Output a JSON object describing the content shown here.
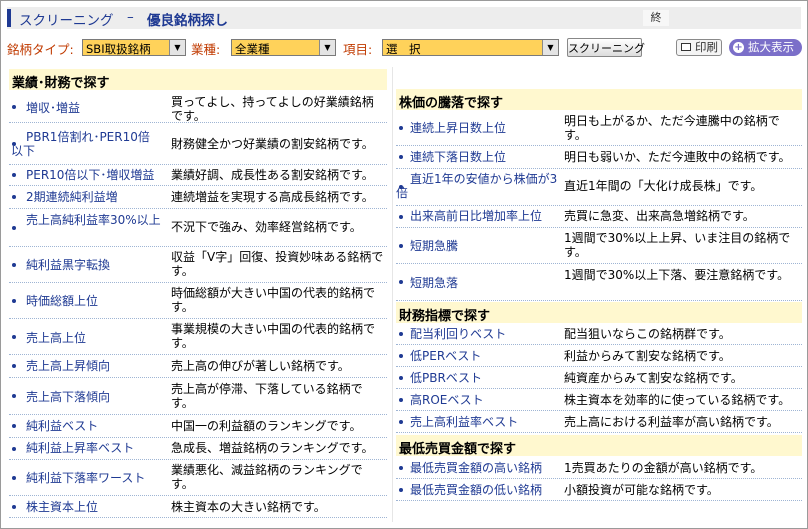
{
  "window": {
    "title_main": "スクリーニング",
    "title_sep": "–",
    "title_sub": "優良銘柄探し",
    "close_label": "終"
  },
  "toolbar": {
    "stock_type_label": "銘柄タイプ:",
    "stock_type_value": "SBI取扱銘柄",
    "industry_label": "業種:",
    "industry_value": "全業種",
    "item_label": "項目:",
    "item_value": "選　択",
    "screening_button": "スクリーニング",
    "print_button": "印刷",
    "zoom_button": "拡大表示",
    "accent_color": "#ffd25a",
    "label_color": "#c03a00"
  },
  "left": {
    "section_title": "業績･財務で探す",
    "rows": [
      {
        "link": "増収･増益",
        "desc": "買ってよし、持ってよしの好業績銘柄です。"
      },
      {
        "link": "PBR1倍割れ･PER10倍以下",
        "desc": "財務健全かつ好業績の割安銘柄です。"
      },
      {
        "link": "PER10倍以下･増収増益",
        "desc": "業績好調、成長性ある割安銘柄です。"
      },
      {
        "link": "2期連続純利益増",
        "desc": "連続増益を実現する高成長銘柄です。"
      },
      {
        "link": "売上高純利益率30%以上",
        "desc": "不況下で強み、効率経営銘柄です。"
      },
      {
        "link": "純利益黒字転換",
        "desc": "収益「V字」回復、投資妙味ある銘柄です。"
      },
      {
        "link": "時価総額上位",
        "desc": "時価総額が大きい中国の代表的銘柄です。"
      },
      {
        "link": "売上高上位",
        "desc": "事業規模の大きい中国の代表的銘柄です。"
      },
      {
        "link": "売上高上昇傾向",
        "desc": "売上高の伸びが著しい銘柄です。"
      },
      {
        "link": "売上高下落傾向",
        "desc": "売上高が停滞、下落している銘柄です。"
      },
      {
        "link": "純利益ベスト",
        "desc": "中国一の利益額のランキングです。"
      },
      {
        "link": "純利益上昇率ベスト",
        "desc": "急成長、増益銘柄のランキングです。"
      },
      {
        "link": "純利益下落率ワースト",
        "desc": "業績悪化、減益銘柄のランキングです。"
      },
      {
        "link": "株主資本上位",
        "desc": "株主資本の大きい銘柄です。"
      }
    ]
  },
  "right": {
    "section1_title": "株価の騰落で探す",
    "section1_rows": [
      {
        "link": "連続上昇日数上位",
        "desc": "明日も上がるか、ただ今連騰中の銘柄です。"
      },
      {
        "link": "連続下落日数上位",
        "desc": "明日も弱いか、ただ今連敗中の銘柄です。"
      },
      {
        "link": "直近1年の安値から株価が3倍",
        "desc": "直近1年間の「大化け成長株」です。"
      },
      {
        "link": "出来高前日比増加率上位",
        "desc": "売買に急変、出来高急増銘柄です。"
      },
      {
        "link": "短期急騰",
        "desc": "1週間で30%以上上昇、いま注目の銘柄です。"
      },
      {
        "link": "短期急落",
        "desc": "1週間で30%以上下落、要注意銘柄です。"
      }
    ],
    "section2_title": "財務指標で探す",
    "section2_rows": [
      {
        "link": "配当利回りベスト",
        "desc": "配当狙いならこの銘柄群です。"
      },
      {
        "link": "低PERベスト",
        "desc": "利益からみて割安な銘柄です。"
      },
      {
        "link": "低PBRベスト",
        "desc": "純資産からみて割安な銘柄です。"
      },
      {
        "link": "高ROEベスト",
        "desc": "株主資本を効率的に使っている銘柄です。"
      },
      {
        "link": "売上高利益率ベスト",
        "desc": "売上高における利益率が高い銘柄です。"
      }
    ],
    "section3_title": "最低売買金額で探す",
    "section3_rows": [
      {
        "link": "最低売買金額の高い銘柄",
        "desc": "1売買あたりの金額が高い銘柄です。"
      },
      {
        "link": "最低売買金額の低い銘柄",
        "desc": "小額投資が可能な銘柄です。"
      }
    ]
  }
}
